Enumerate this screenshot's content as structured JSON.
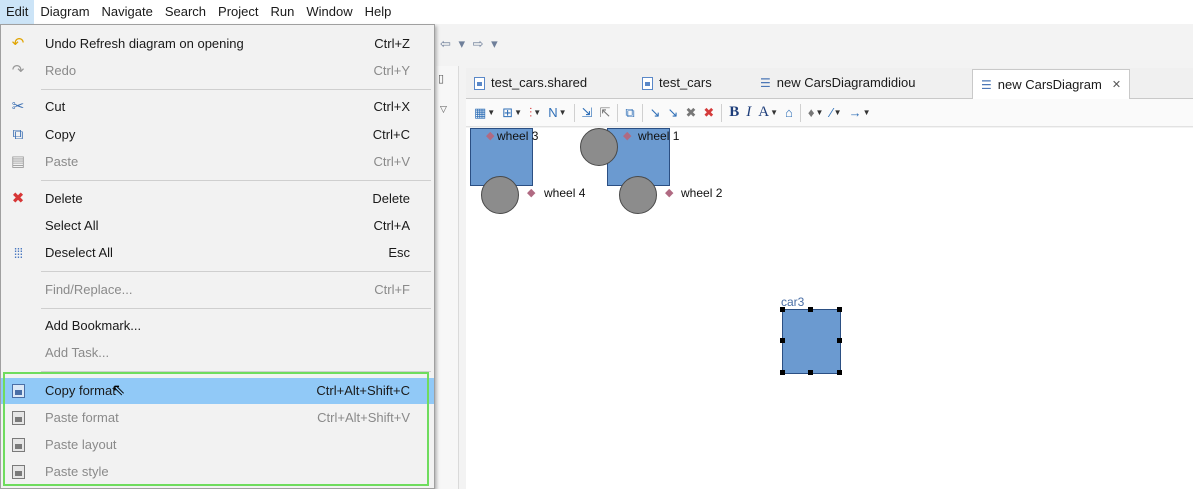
{
  "menubar": {
    "items": [
      {
        "label": "Edit",
        "active": true
      },
      {
        "label": "Diagram"
      },
      {
        "label": "Navigate"
      },
      {
        "label": "Search"
      },
      {
        "label": "Project"
      },
      {
        "label": "Run"
      },
      {
        "label": "Window"
      },
      {
        "label": "Help"
      }
    ]
  },
  "nav_toolbar": {
    "arrows": "⇦ ▾ ⇨ ▾"
  },
  "tabs": [
    {
      "label": "test_cars.shared",
      "icon": "file-icon"
    },
    {
      "label": "test_cars",
      "icon": "file-icon"
    },
    {
      "label": "new CarsDiagramdidiou",
      "icon": "diagram-icon"
    },
    {
      "label": "new CarsDiagram",
      "icon": "diagram-icon",
      "active": true,
      "close": "✕"
    }
  ],
  "diagram": {
    "labels": {
      "wheel3": "wheel 3",
      "wheel1": "wheel 1",
      "wheel4": "wheel 4",
      "wheel2": "wheel 2",
      "car3": "car3"
    }
  },
  "edit_menu": {
    "items": [
      {
        "label": "Undo Refresh diagram on opening",
        "shortcut": "Ctrl+Z",
        "icon": "undo-icon"
      },
      {
        "label": "Redo",
        "shortcut": "Ctrl+Y",
        "icon": "redo-icon",
        "disabled": true
      },
      {
        "label": "Cut",
        "shortcut": "Ctrl+X",
        "icon": "cut-icon"
      },
      {
        "label": "Copy",
        "shortcut": "Ctrl+C",
        "icon": "copy-icon"
      },
      {
        "label": "Paste",
        "shortcut": "Ctrl+V",
        "icon": "paste-icon",
        "disabled": true
      },
      {
        "label": "Delete",
        "shortcut": "Delete",
        "icon": "delete-icon"
      },
      {
        "label": "Select All",
        "shortcut": "Ctrl+A"
      },
      {
        "label": "Deselect All",
        "shortcut": "Esc",
        "icon": "deselect-icon"
      },
      {
        "label": "Find/Replace...",
        "shortcut": "Ctrl+F",
        "disabled": true
      },
      {
        "label": "Add Bookmark...",
        "shortcut": ""
      },
      {
        "label": "Add Task...",
        "shortcut": "",
        "disabled": true
      },
      {
        "label": "Copy format",
        "shortcut": "Ctrl+Alt+Shift+C",
        "icon": "copy-format-icon",
        "highlighted": true
      },
      {
        "label": "Paste format",
        "shortcut": "Ctrl+Alt+Shift+V",
        "icon": "paste-format-icon",
        "disabled": true
      },
      {
        "label": "Paste layout",
        "shortcut": "",
        "icon": "paste-layout-icon",
        "disabled": true
      },
      {
        "label": "Paste style",
        "shortcut": "",
        "icon": "paste-style-icon",
        "disabled": true
      }
    ]
  },
  "colors": {
    "highlight": "#91c9f7",
    "callout_border": "#6fdc5e",
    "car_fill": "#6b9ad0",
    "wheel_fill": "#8c8c8c"
  }
}
